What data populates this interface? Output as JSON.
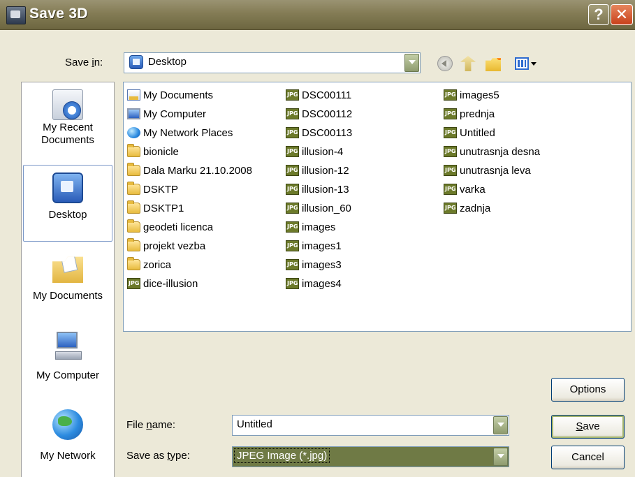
{
  "window": {
    "title": "Save 3D"
  },
  "titlebar": {
    "help_glyph": "?",
    "close_glyph": "✕"
  },
  "save_in": {
    "label_pre": "Save ",
    "label_key": "i",
    "label_post": "n:",
    "value": "Desktop"
  },
  "places": [
    {
      "name": "recent",
      "lines": [
        "My Recent",
        "Documents"
      ]
    },
    {
      "name": "desktop",
      "lines": [
        "Desktop"
      ]
    },
    {
      "name": "mydocs",
      "lines": [
        "My Documents"
      ]
    },
    {
      "name": "mycomp",
      "lines": [
        "My Computer"
      ]
    },
    {
      "name": "network",
      "lines": [
        "My Network"
      ]
    }
  ],
  "files": {
    "col1": [
      {
        "name": "My Documents",
        "icon": "mydocs"
      },
      {
        "name": "My Computer",
        "icon": "mycomp"
      },
      {
        "name": "My Network Places",
        "icon": "network"
      },
      {
        "name": "bionicle",
        "icon": "folder"
      },
      {
        "name": "Dala Marku 21.10.2008",
        "icon": "folder"
      },
      {
        "name": "DSKTP",
        "icon": "folder"
      },
      {
        "name": "DSKTP1",
        "icon": "folder"
      },
      {
        "name": "geodeti licenca",
        "icon": "folder"
      },
      {
        "name": "projekt vezba",
        "icon": "folder"
      },
      {
        "name": "zorica",
        "icon": "folder"
      },
      {
        "name": "dice-illusion",
        "icon": "jpg"
      }
    ],
    "col2": [
      {
        "name": "DSC00111",
        "icon": "jpg"
      },
      {
        "name": "DSC00112",
        "icon": "jpg"
      },
      {
        "name": "DSC00113",
        "icon": "jpg"
      },
      {
        "name": "illusion-4",
        "icon": "jpg"
      },
      {
        "name": "illusion-12",
        "icon": "jpg"
      },
      {
        "name": "illusion-13",
        "icon": "jpg"
      },
      {
        "name": "illusion_60",
        "icon": "jpg"
      },
      {
        "name": "images",
        "icon": "jpg"
      },
      {
        "name": "images1",
        "icon": "jpg"
      },
      {
        "name": "images3",
        "icon": "jpg"
      },
      {
        "name": "images4",
        "icon": "jpg"
      }
    ],
    "col3": [
      {
        "name": "images5",
        "icon": "jpg"
      },
      {
        "name": "prednja",
        "icon": "jpg"
      },
      {
        "name": "Untitled",
        "icon": "jpg"
      },
      {
        "name": "unutrasnja desna",
        "icon": "jpg"
      },
      {
        "name": "unutrasnja leva",
        "icon": "jpg"
      },
      {
        "name": "varka",
        "icon": "jpg"
      },
      {
        "name": "zadnja",
        "icon": "jpg"
      }
    ]
  },
  "file_name": {
    "label_pre": "File ",
    "label_key": "n",
    "label_post": "ame:",
    "value": "Untitled"
  },
  "save_as_type": {
    "label_pre": "Save as ",
    "label_key": "t",
    "label_post": "ype:",
    "value": "JPEG Image (*.jpg)"
  },
  "buttons": {
    "options": "Options",
    "save_key": "S",
    "save_rest": "ave",
    "cancel": "Cancel"
  },
  "colors": {
    "titlebar": "#847c55",
    "dialog_bg": "#ece9d8",
    "selection": "#6f7a45",
    "close": "#c8401b"
  }
}
